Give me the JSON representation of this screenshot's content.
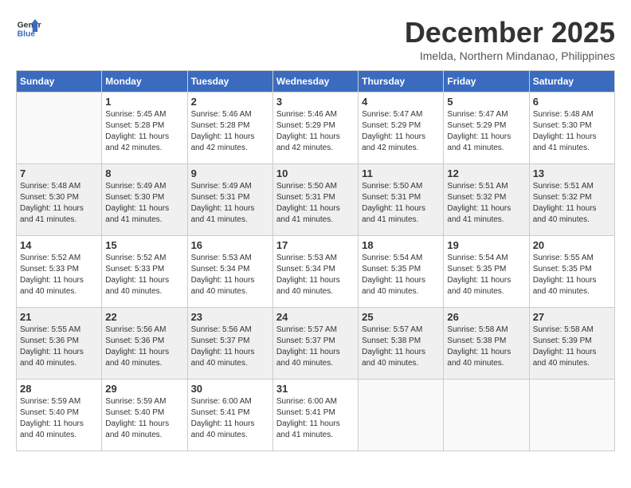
{
  "header": {
    "logo_line1": "General",
    "logo_line2": "Blue",
    "month": "December 2025",
    "location": "Imelda, Northern Mindanao, Philippines"
  },
  "days_of_week": [
    "Sunday",
    "Monday",
    "Tuesday",
    "Wednesday",
    "Thursday",
    "Friday",
    "Saturday"
  ],
  "weeks": [
    [
      {
        "day": "",
        "sunrise": "",
        "sunset": "",
        "daylight": ""
      },
      {
        "day": "1",
        "sunrise": "Sunrise: 5:45 AM",
        "sunset": "Sunset: 5:28 PM",
        "daylight": "Daylight: 11 hours and 42 minutes."
      },
      {
        "day": "2",
        "sunrise": "Sunrise: 5:46 AM",
        "sunset": "Sunset: 5:28 PM",
        "daylight": "Daylight: 11 hours and 42 minutes."
      },
      {
        "day": "3",
        "sunrise": "Sunrise: 5:46 AM",
        "sunset": "Sunset: 5:29 PM",
        "daylight": "Daylight: 11 hours and 42 minutes."
      },
      {
        "day": "4",
        "sunrise": "Sunrise: 5:47 AM",
        "sunset": "Sunset: 5:29 PM",
        "daylight": "Daylight: 11 hours and 42 minutes."
      },
      {
        "day": "5",
        "sunrise": "Sunrise: 5:47 AM",
        "sunset": "Sunset: 5:29 PM",
        "daylight": "Daylight: 11 hours and 41 minutes."
      },
      {
        "day": "6",
        "sunrise": "Sunrise: 5:48 AM",
        "sunset": "Sunset: 5:30 PM",
        "daylight": "Daylight: 11 hours and 41 minutes."
      }
    ],
    [
      {
        "day": "7",
        "sunrise": "Sunrise: 5:48 AM",
        "sunset": "Sunset: 5:30 PM",
        "daylight": "Daylight: 11 hours and 41 minutes."
      },
      {
        "day": "8",
        "sunrise": "Sunrise: 5:49 AM",
        "sunset": "Sunset: 5:30 PM",
        "daylight": "Daylight: 11 hours and 41 minutes."
      },
      {
        "day": "9",
        "sunrise": "Sunrise: 5:49 AM",
        "sunset": "Sunset: 5:31 PM",
        "daylight": "Daylight: 11 hours and 41 minutes."
      },
      {
        "day": "10",
        "sunrise": "Sunrise: 5:50 AM",
        "sunset": "Sunset: 5:31 PM",
        "daylight": "Daylight: 11 hours and 41 minutes."
      },
      {
        "day": "11",
        "sunrise": "Sunrise: 5:50 AM",
        "sunset": "Sunset: 5:31 PM",
        "daylight": "Daylight: 11 hours and 41 minutes."
      },
      {
        "day": "12",
        "sunrise": "Sunrise: 5:51 AM",
        "sunset": "Sunset: 5:32 PM",
        "daylight": "Daylight: 11 hours and 41 minutes."
      },
      {
        "day": "13",
        "sunrise": "Sunrise: 5:51 AM",
        "sunset": "Sunset: 5:32 PM",
        "daylight": "Daylight: 11 hours and 40 minutes."
      }
    ],
    [
      {
        "day": "14",
        "sunrise": "Sunrise: 5:52 AM",
        "sunset": "Sunset: 5:33 PM",
        "daylight": "Daylight: 11 hours and 40 minutes."
      },
      {
        "day": "15",
        "sunrise": "Sunrise: 5:52 AM",
        "sunset": "Sunset: 5:33 PM",
        "daylight": "Daylight: 11 hours and 40 minutes."
      },
      {
        "day": "16",
        "sunrise": "Sunrise: 5:53 AM",
        "sunset": "Sunset: 5:34 PM",
        "daylight": "Daylight: 11 hours and 40 minutes."
      },
      {
        "day": "17",
        "sunrise": "Sunrise: 5:53 AM",
        "sunset": "Sunset: 5:34 PM",
        "daylight": "Daylight: 11 hours and 40 minutes."
      },
      {
        "day": "18",
        "sunrise": "Sunrise: 5:54 AM",
        "sunset": "Sunset: 5:35 PM",
        "daylight": "Daylight: 11 hours and 40 minutes."
      },
      {
        "day": "19",
        "sunrise": "Sunrise: 5:54 AM",
        "sunset": "Sunset: 5:35 PM",
        "daylight": "Daylight: 11 hours and 40 minutes."
      },
      {
        "day": "20",
        "sunrise": "Sunrise: 5:55 AM",
        "sunset": "Sunset: 5:35 PM",
        "daylight": "Daylight: 11 hours and 40 minutes."
      }
    ],
    [
      {
        "day": "21",
        "sunrise": "Sunrise: 5:55 AM",
        "sunset": "Sunset: 5:36 PM",
        "daylight": "Daylight: 11 hours and 40 minutes."
      },
      {
        "day": "22",
        "sunrise": "Sunrise: 5:56 AM",
        "sunset": "Sunset: 5:36 PM",
        "daylight": "Daylight: 11 hours and 40 minutes."
      },
      {
        "day": "23",
        "sunrise": "Sunrise: 5:56 AM",
        "sunset": "Sunset: 5:37 PM",
        "daylight": "Daylight: 11 hours and 40 minutes."
      },
      {
        "day": "24",
        "sunrise": "Sunrise: 5:57 AM",
        "sunset": "Sunset: 5:37 PM",
        "daylight": "Daylight: 11 hours and 40 minutes."
      },
      {
        "day": "25",
        "sunrise": "Sunrise: 5:57 AM",
        "sunset": "Sunset: 5:38 PM",
        "daylight": "Daylight: 11 hours and 40 minutes."
      },
      {
        "day": "26",
        "sunrise": "Sunrise: 5:58 AM",
        "sunset": "Sunset: 5:38 PM",
        "daylight": "Daylight: 11 hours and 40 minutes."
      },
      {
        "day": "27",
        "sunrise": "Sunrise: 5:58 AM",
        "sunset": "Sunset: 5:39 PM",
        "daylight": "Daylight: 11 hours and 40 minutes."
      }
    ],
    [
      {
        "day": "28",
        "sunrise": "Sunrise: 5:59 AM",
        "sunset": "Sunset: 5:40 PM",
        "daylight": "Daylight: 11 hours and 40 minutes."
      },
      {
        "day": "29",
        "sunrise": "Sunrise: 5:59 AM",
        "sunset": "Sunset: 5:40 PM",
        "daylight": "Daylight: 11 hours and 40 minutes."
      },
      {
        "day": "30",
        "sunrise": "Sunrise: 6:00 AM",
        "sunset": "Sunset: 5:41 PM",
        "daylight": "Daylight: 11 hours and 40 minutes."
      },
      {
        "day": "31",
        "sunrise": "Sunrise: 6:00 AM",
        "sunset": "Sunset: 5:41 PM",
        "daylight": "Daylight: 11 hours and 41 minutes."
      },
      {
        "day": "",
        "sunrise": "",
        "sunset": "",
        "daylight": ""
      },
      {
        "day": "",
        "sunrise": "",
        "sunset": "",
        "daylight": ""
      },
      {
        "day": "",
        "sunrise": "",
        "sunset": "",
        "daylight": ""
      }
    ]
  ]
}
